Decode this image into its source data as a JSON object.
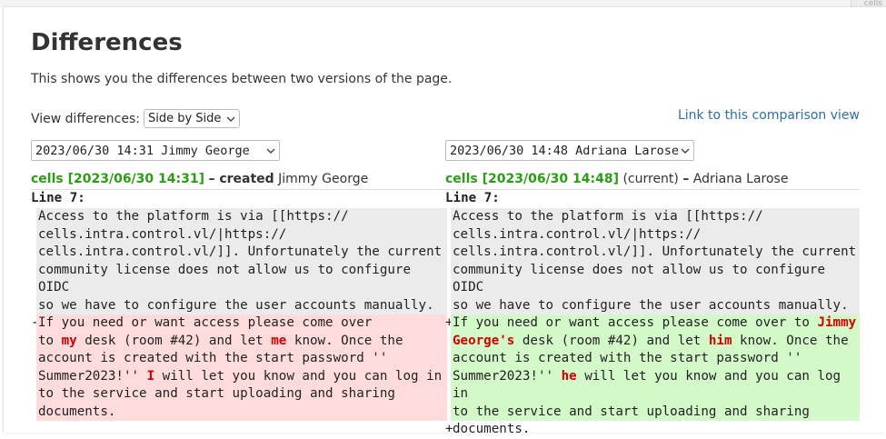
{
  "corner_tag": "cells",
  "page_title": "Differences",
  "intro": "This shows you the differences between two versions of the page.",
  "view_diff": {
    "label": "View differences:",
    "selected": "Side by Side"
  },
  "comparison_link": "Link to this comparison view",
  "left": {
    "revision_select": "2023/06/30 14:31 Jimmy George",
    "rev_link": "cells [2023/06/30 14:31]",
    "summary": "– created",
    "author": "Jimmy George",
    "line_label": "Line 7:",
    "context": "Access to the platform is via [[https://\ncells.intra.control.vl/|https://\ncells.intra.control.vl/]]. Unfortunately the current\ncommunity license does not allow us to configure OIDC\nso we have to configure the user accounts manually.",
    "marker": "-",
    "changed": {
      "t1": "If you need or want access please come over\nto ",
      "h1": "my",
      "t2": " desk (room #42) and let ",
      "h2": "me",
      "t3": " know. Once the\naccount is created with the start password ''\nSummer2023!'' ",
      "h3": "I",
      "t4": " will let you know and you can log in\nto the service and start uploading and sharing\ndocuments."
    }
  },
  "right": {
    "revision_select": "2023/06/30 14:48 Adriana Larose",
    "rev_link": "cells [2023/06/30 14:48]",
    "status": "(current)",
    "author_sep": "–",
    "author": "Adriana Larose",
    "line_label": "Line 7:",
    "context": "Access to the platform is via [[https://\ncells.intra.control.vl/|https://\ncells.intra.control.vl/]]. Unfortunately the current\ncommunity license does not allow us to configure OIDC\nso we have to configure the user accounts manually.",
    "marker": "+",
    "marker2": "+",
    "changed": {
      "t1": "If you need or want access please come over to ",
      "h1": "Jimmy\nGeorge's",
      "t2": " desk (room #42) and let ",
      "h2": "him",
      "t3": " know. Once the\naccount is created with the start password ''\nSummer2023!'' ",
      "h3": "he",
      "t4": " will let you know and you can log in\nto the service and start uploading and sharing\ndocuments."
    }
  }
}
